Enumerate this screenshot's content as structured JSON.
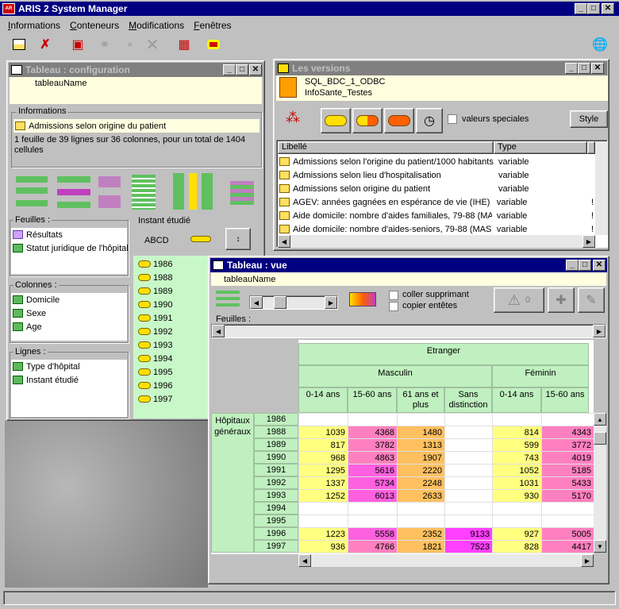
{
  "app": {
    "title": "ARIS 2 System Manager",
    "menu": [
      "Informations",
      "Conteneurs",
      "Modifications",
      "Fenêtres"
    ]
  },
  "toolbar": {
    "icons": [
      "layout-icon",
      "delete-icon",
      "cube-icon",
      "link-icon",
      "small-close-icon",
      "large-close-icon",
      "record-icon",
      "tag-icon",
      "globe-icon"
    ]
  },
  "config": {
    "title": "Tableau : configuration",
    "name": "tableauName",
    "info_label": "Informations",
    "info_value": "Admissions selon origine du patient",
    "info_desc": "1 feuille de 39 lignes sur 36 colonnes, pour un total de 1404 cellules",
    "feuilles_label": "Feuilles :",
    "feuilles": [
      "Résultats",
      "Statut juridique de l'hôpital"
    ],
    "colonnes_label": "Colonnes :",
    "colonnes": [
      "Domicile",
      "Sexe",
      "Age"
    ],
    "lignes_label": "Lignes :",
    "lignes": [
      "Type d'hôpital",
      "Instant étudié"
    ],
    "instant_label": "Instant étudié",
    "abcd": "ABCD",
    "years": [
      "1986",
      "1988",
      "1989",
      "1990",
      "1991",
      "1992",
      "1993",
      "1994",
      "1995",
      "1996",
      "1997"
    ]
  },
  "versions": {
    "title": "Les versions",
    "db": "SQL_BDC_1_ODBC",
    "schema": "InfoSante_Testes",
    "special_label": "valeurs speciales",
    "style_button": "Style",
    "col_libelle": "Libellé",
    "col_type": "Type",
    "rows": [
      {
        "label": "Admissions selon l'origine du patient/1000 habitants",
        "type": "variable"
      },
      {
        "label": "Admissions selon lieu d'hospitalisation",
        "type": "variable"
      },
      {
        "label": "Admissions selon origine du patient",
        "type": "variable"
      },
      {
        "label": "AGEV: années gagnées en espérance de vie (IHE)",
        "type": "variable",
        "mark": "!"
      },
      {
        "label": "Aide domicile: nombre d'aides familiales, 79-88 (MAS)",
        "type": "variable",
        "mark": "!"
      },
      {
        "label": "Aide domicile: nombre d'aides-seniors, 79-88 (MAS)",
        "type": "variable",
        "mark": "!"
      }
    ]
  },
  "vue": {
    "title": "Tableau : vue",
    "name": "tableauName",
    "coller": "coller supprimant",
    "copier": "copier entêtes",
    "warn_count": "0",
    "feuilles_label": "Feuilles :",
    "etranger": "Etranger",
    "masculin": "Masculin",
    "feminin": "Féminin",
    "age_cols": [
      "0-14 ans",
      "15-60 ans",
      "61 ans et plus",
      "Sans distinction",
      "0-14 ans",
      "15-60 ans"
    ],
    "row_group": "Hôpitaux généraux",
    "years": [
      "1986",
      "1988",
      "1989",
      "1990",
      "1991",
      "1992",
      "1993",
      "1994",
      "1995",
      "1996",
      "1997"
    ],
    "cells": [
      [
        "",
        "",
        "",
        "",
        "",
        ""
      ],
      [
        "1039",
        "4368",
        "1480",
        "",
        "814",
        "4343"
      ],
      [
        "817",
        "3782",
        "1313",
        "",
        "599",
        "3772"
      ],
      [
        "968",
        "4863",
        "1907",
        "",
        "743",
        "4019"
      ],
      [
        "1295",
        "5616",
        "2220",
        "",
        "1052",
        "5185"
      ],
      [
        "1337",
        "5734",
        "2248",
        "",
        "1031",
        "5433"
      ],
      [
        "1252",
        "6013",
        "2633",
        "",
        "930",
        "5170"
      ],
      [
        "",
        "",
        "",
        "",
        "",
        ""
      ],
      [
        "",
        "",
        "",
        "",
        "",
        ""
      ],
      [
        "1223",
        "5558",
        "2352",
        "9133",
        "927",
        "5005"
      ],
      [
        "936",
        "4766",
        "1821",
        "7523",
        "828",
        "4417"
      ]
    ]
  },
  "colors": {
    "title_active": "#000080",
    "title_inactive": "#808080",
    "grid_header": "#c0f0c0",
    "yellow": "#ffff80",
    "pink": "#ff80c0",
    "orange": "#ffc060",
    "magenta": "#ff40ff"
  }
}
